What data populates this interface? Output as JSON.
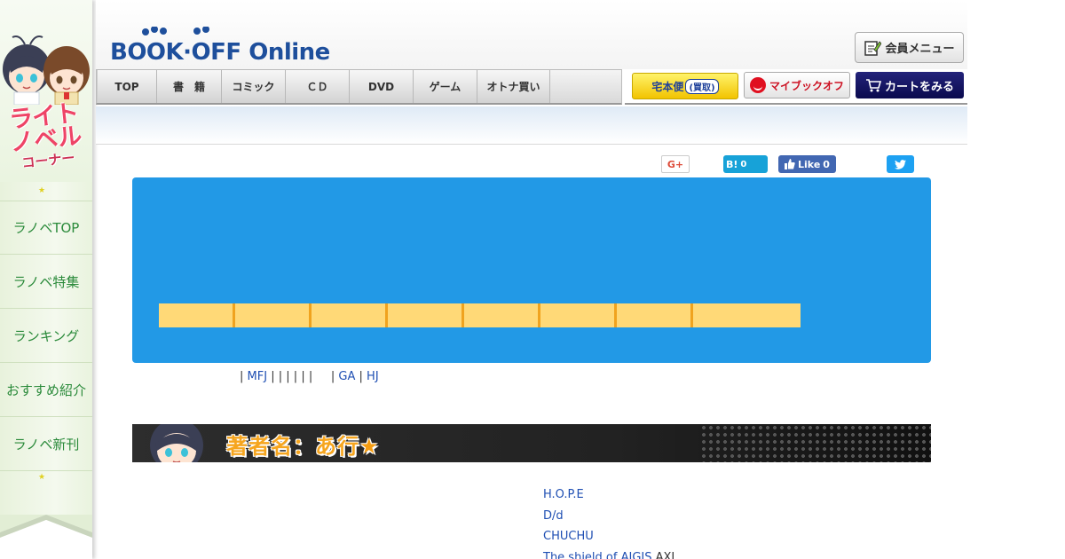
{
  "sidebar": {
    "banner_title_line1": "ライト",
    "banner_title_line2": "ノベル",
    "banner_title_line3": "コーナー",
    "star_icon": "star-icon",
    "items": [
      {
        "label": "ラノベTOP"
      },
      {
        "label": "ラノベ特集"
      },
      {
        "label": "ランキング"
      },
      {
        "label": "おすすめ紹介"
      },
      {
        "label": "ラノベ新刊"
      }
    ]
  },
  "header": {
    "logo_text": "BOOK·OFF Online",
    "member_menu_label": "会員メニュー",
    "nav_tabs": [
      {
        "label": "TOP"
      },
      {
        "label": "書　籍"
      },
      {
        "label": "コミック"
      },
      {
        "label": "ＣＤ"
      },
      {
        "label": "DVD"
      },
      {
        "label": "ゲーム"
      },
      {
        "label": "オトナ買い"
      }
    ],
    "takuhaibin_label": "宅本便",
    "kaitori_label": "(買取)",
    "mybookoff_label": "マイブックオフ",
    "cart_label": "カートをみる"
  },
  "social": {
    "gplus_label": "G+",
    "hatena_label": "B!",
    "hatena_count": "0",
    "fb_like_label": "Like",
    "fb_like_count": "0"
  },
  "category_tabs": {
    "count": 8
  },
  "publisher_links": {
    "items": [
      "|",
      " MFJ ",
      "|",
      " ",
      "|",
      " ",
      "|",
      " ",
      "|",
      " ",
      "|",
      " ",
      "|",
      "     ",
      "|",
      " GA ",
      "|",
      " HJ"
    ]
  },
  "author_section": {
    "title": "著者名：あ行",
    "titles": [
      {
        "text": "H.O.P.E",
        "suffix": ""
      },
      {
        "text": "D/d",
        "suffix": ""
      },
      {
        "text": "CHUCHU",
        "suffix": ""
      },
      {
        "text": " The shield of AIGIS",
        "suffix": "  AXI"
      }
    ]
  },
  "colors": {
    "panel_blue": "#2299e6",
    "tab_yellow": "#ffd977",
    "tab_border": "#f0a31e",
    "link_blue": "#1f4fb3",
    "sidebar_green": "#2a8a3a",
    "banner_orange": "#f6a51e"
  }
}
